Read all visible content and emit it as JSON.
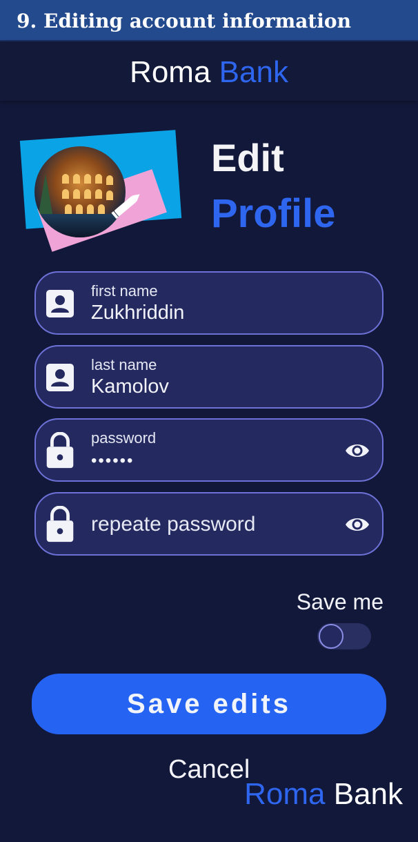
{
  "caption": "9. Editing account information",
  "header": {
    "brand_part1": "Roma",
    "brand_part2": "Bank"
  },
  "profile": {
    "title_line1": "Edit",
    "title_line2": "Profile",
    "avatar_icon": "photo-colosseum",
    "edit_icon": "pencil-icon"
  },
  "form": {
    "first_name": {
      "label": "first name",
      "value": "Zukhriddin",
      "icon": "contact-icon"
    },
    "last_name": {
      "label": "last name",
      "value": "Kamolov",
      "icon": "contact-icon"
    },
    "password": {
      "label": "password",
      "value": "••••••",
      "icon": "lock-icon",
      "toggle_icon": "eye-icon"
    },
    "repeat_password": {
      "placeholder": "repeate password",
      "icon": "lock-icon",
      "toggle_icon": "eye-icon"
    }
  },
  "save_me": {
    "label": "Save me",
    "checked": false
  },
  "actions": {
    "save_label": "Save edits",
    "cancel_label": "Cancel"
  },
  "footer": {
    "brand_part1": "Roma",
    "brand_part2": "Bank"
  },
  "colors": {
    "background": "#12183a",
    "accent": "#2e66f0",
    "field_bg": "#242a60",
    "field_border": "#6e72d8",
    "button": "#2563f2",
    "caption_bg": "#244a8e"
  }
}
